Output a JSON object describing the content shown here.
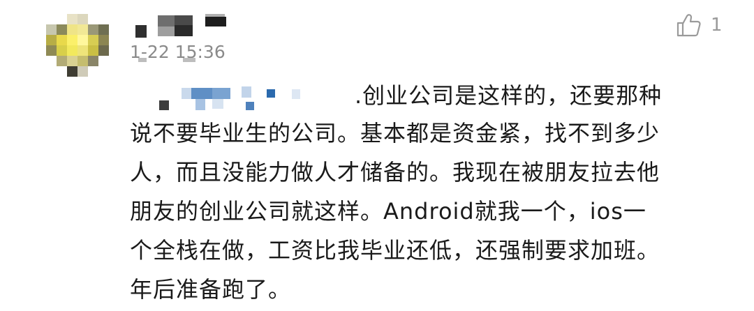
{
  "comment": {
    "timestamp": "1-22 15:36",
    "likes": "1",
    "like_icon": "thumbs-up-icon",
    "lines": [
      ".创业公司是这样的，还要那种",
      "说不要毕业生的公司。基本都是资金紧，找不到多少",
      "人，而且没能力做人才储备的。我现在被朋友拉去他",
      "朋友的创业公司就这样。Android就我一个，ios一",
      "个全栈在做，工资比我毕业还低，还强制要求加班。",
      "年后准备跑了。"
    ]
  }
}
